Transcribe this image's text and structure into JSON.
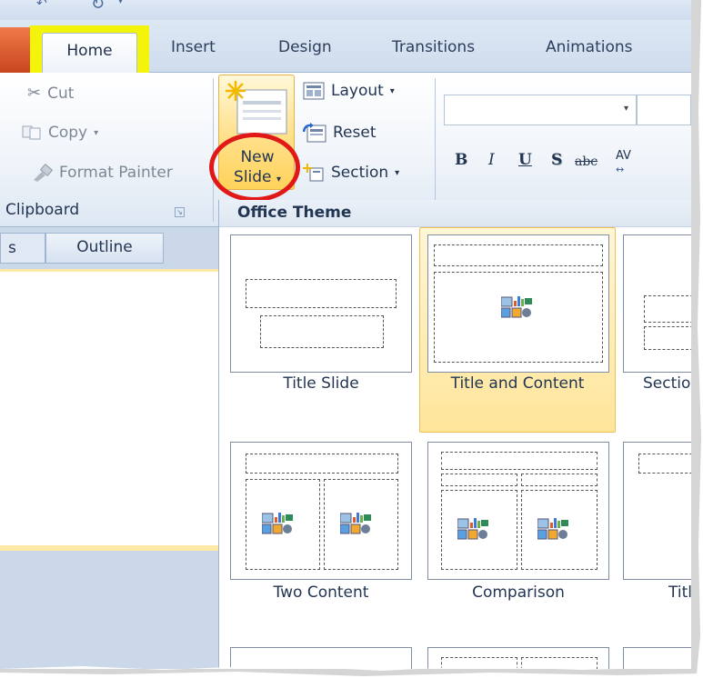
{
  "tabs": {
    "home": "Home",
    "insert": "Insert",
    "design": "Design",
    "transitions": "Transitions",
    "animations": "Animations"
  },
  "clipboard": {
    "cut": "Cut",
    "copy": "Copy",
    "format_painter": "Format Painter",
    "group_label": "Clipboard"
  },
  "slides": {
    "new_slide_line1": "New",
    "new_slide_line2": "Slide",
    "layout": "Layout",
    "reset": "Reset",
    "section": "Section"
  },
  "font": {
    "bold": "B",
    "italic": "I",
    "underline": "U",
    "shadow": "S",
    "strike": "abc",
    "spacing": "AV"
  },
  "left_pane": {
    "slides_tab": "s",
    "outline_tab": "Outline"
  },
  "gallery": {
    "title": "Office Theme",
    "layouts": [
      "Title Slide",
      "Title and Content",
      "Sectio",
      "Two Content",
      "Comparison",
      "Titl"
    ]
  },
  "colors": {
    "highlight_yellow": "#f4f30a",
    "annotation_red": "#e01818",
    "selected_gold": "#ffe59a"
  }
}
